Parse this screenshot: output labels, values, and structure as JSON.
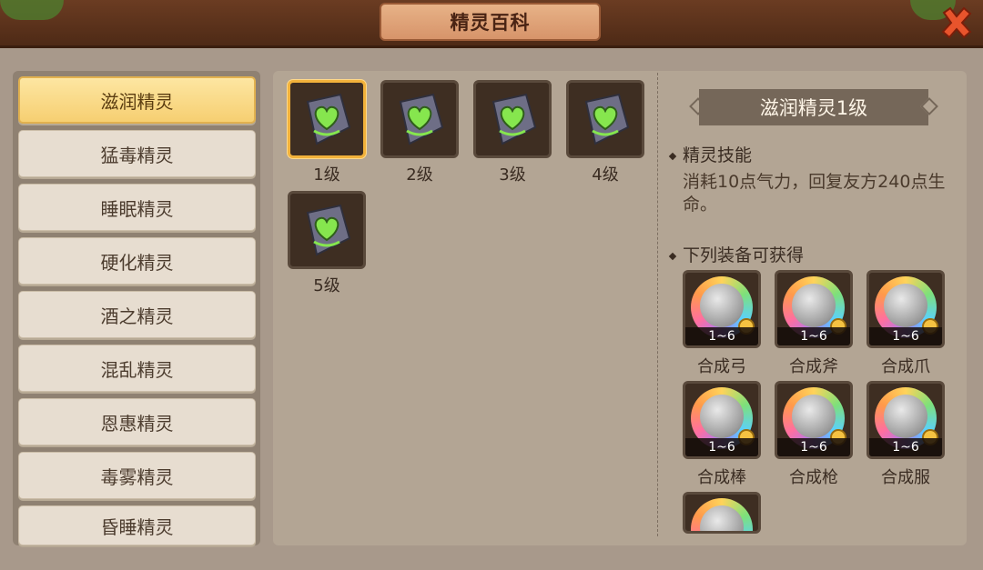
{
  "header": {
    "title": "精灵百科",
    "close_icon": "close-x-icon"
  },
  "sidebar": {
    "items": [
      {
        "label": "滋润精灵",
        "active": true
      },
      {
        "label": "猛毒精灵"
      },
      {
        "label": "睡眠精灵"
      },
      {
        "label": "硬化精灵"
      },
      {
        "label": "酒之精灵"
      },
      {
        "label": "混乱精灵"
      },
      {
        "label": "恩惠精灵"
      },
      {
        "label": "毒雾精灵"
      },
      {
        "label": "昏睡精灵"
      }
    ]
  },
  "levels": [
    {
      "label": "1级",
      "icon": "green-heart-stone-icon",
      "selected": true
    },
    {
      "label": "2级",
      "icon": "green-heart-stone-icon"
    },
    {
      "label": "3级",
      "icon": "green-heart-stone-icon"
    },
    {
      "label": "4级",
      "icon": "green-heart-stone-icon"
    },
    {
      "label": "5级",
      "icon": "green-heart-stone-icon"
    }
  ],
  "detail": {
    "title": "滋润精灵1级",
    "skill_header": "精灵技能",
    "skill_desc": "消耗10点气力，回复友方240点生命。",
    "obtain_header": "下列装备可获得",
    "equipment": [
      {
        "label": "合成弓",
        "level": "1~6",
        "icon": "bow-icon"
      },
      {
        "label": "合成斧",
        "level": "1~6",
        "icon": "axe-icon"
      },
      {
        "label": "合成爪",
        "level": "1~6",
        "icon": "claw-icon"
      },
      {
        "label": "合成棒",
        "level": "1~6",
        "icon": "club-icon"
      },
      {
        "label": "合成枪",
        "level": "1~6",
        "icon": "spear-icon"
      },
      {
        "label": "合成服",
        "level": "1~6",
        "icon": "armor-icon"
      },
      {
        "label": "",
        "level": "",
        "icon": "armor-icon"
      }
    ]
  },
  "colors": {
    "accent": "#f2b23b",
    "active_tab": "#f6cf72",
    "heart": "#7be04a"
  }
}
